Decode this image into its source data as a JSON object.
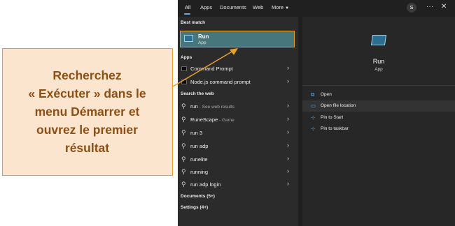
{
  "tabs": [
    {
      "label": "All"
    },
    {
      "label": "Apps"
    },
    {
      "label": "Documents"
    },
    {
      "label": "Web"
    },
    {
      "label": "More"
    }
  ],
  "user_initial": "S",
  "more_options": "···",
  "close_symbol": "✕",
  "best_match": {
    "heading": "Best match",
    "title": "Run",
    "type": "App"
  },
  "apps_section": {
    "heading": "Apps",
    "items": [
      {
        "label": "Command Prompt"
      },
      {
        "label": "Node.js command prompt"
      }
    ]
  },
  "web_section": {
    "heading": "Search the web",
    "items": [
      {
        "label": "run",
        "suffix": " - See web results"
      },
      {
        "label": "RuneScape",
        "suffix": " - Game"
      },
      {
        "label": "run 3",
        "suffix": ""
      },
      {
        "label": "run adp",
        "suffix": ""
      },
      {
        "label": "runelite",
        "suffix": ""
      },
      {
        "label": "running",
        "suffix": ""
      },
      {
        "label": "run adp login",
        "suffix": ""
      }
    ]
  },
  "documents_section": "Documents (5+)",
  "settings_section": "Settings (4+)",
  "detail": {
    "title": "Run",
    "type": "App",
    "actions": [
      {
        "label": "Open",
        "icon": "open-icon"
      },
      {
        "label": "Open file location",
        "icon": "folder-icon"
      },
      {
        "label": "Pin to Start",
        "icon": "pin-icon"
      },
      {
        "label": "Pin to taskbar",
        "icon": "pin-icon"
      }
    ]
  },
  "callout": {
    "line1": "Recherchez",
    "line2": "« Exécuter » dans le",
    "line3": "menu Démarrer et",
    "line4": "ouvrez le premier",
    "line5": "résultat"
  },
  "colors": {
    "accent_orange": "#e8a02b",
    "callout_fill": "#fbe5cf",
    "callout_text": "#8d4f14",
    "selected_row": "#47777c",
    "panel_bg": "#202020"
  }
}
